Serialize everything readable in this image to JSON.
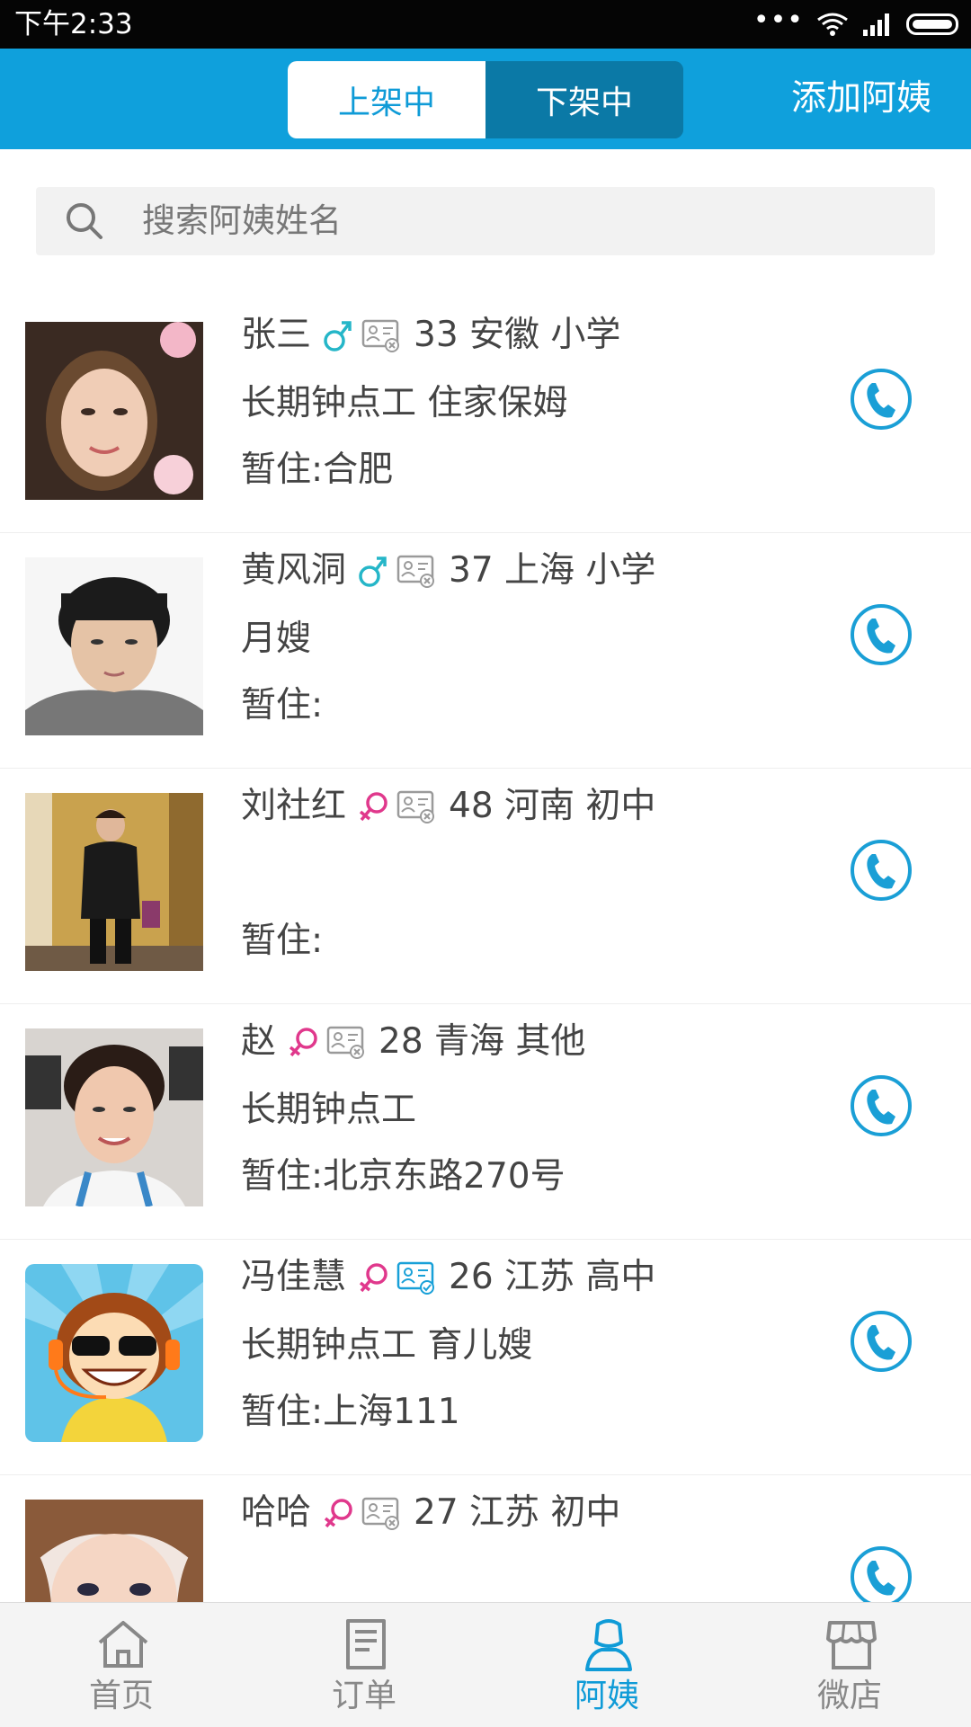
{
  "status_bar": {
    "time": "下午2:33",
    "dots": "•••"
  },
  "header": {
    "tabs": [
      {
        "label": "上架中",
        "active": true
      },
      {
        "label": "下架中",
        "active": false
      }
    ],
    "add_button": "添加阿姨"
  },
  "search": {
    "placeholder": "搜索阿姨姓名"
  },
  "workers": [
    {
      "name": "张三",
      "gender": "male",
      "id_verified": false,
      "details": "33 安徽 小学",
      "services": "长期钟点工 住家保姆",
      "address": "暂住:合肥"
    },
    {
      "name": "黄风洞",
      "gender": "male",
      "id_verified": false,
      "details": "37 上海 小学",
      "services": "月嫂",
      "address": "暂住:"
    },
    {
      "name": "刘社红",
      "gender": "female",
      "id_verified": false,
      "details": "48 河南 初中",
      "services": "",
      "address": "暂住:"
    },
    {
      "name": "赵",
      "gender": "female",
      "id_verified": false,
      "details": "28 青海 其他",
      "services": "长期钟点工",
      "address": "暂住:北京东路270号"
    },
    {
      "name": "冯佳慧",
      "gender": "female",
      "id_verified": true,
      "details": "26 江苏 高中",
      "services": "长期钟点工 育儿嫂",
      "address": "暂住:上海111"
    },
    {
      "name": "哈哈",
      "gender": "female",
      "id_verified": false,
      "details": "27 江苏 初中",
      "services": "",
      "address": ""
    }
  ],
  "nav": [
    {
      "label": "首页",
      "icon": "home-icon",
      "active": false
    },
    {
      "label": "订单",
      "icon": "order-icon",
      "active": false
    },
    {
      "label": "阿姨",
      "icon": "auntie-icon",
      "active": true
    },
    {
      "label": "微店",
      "icon": "shop-icon",
      "active": false
    }
  ],
  "colors": {
    "accent": "#0fa0dc",
    "male": "#25b6c8",
    "female": "#e0388c",
    "id_verified": "#18a0d8",
    "id_unverified": "#9a9a9a"
  }
}
